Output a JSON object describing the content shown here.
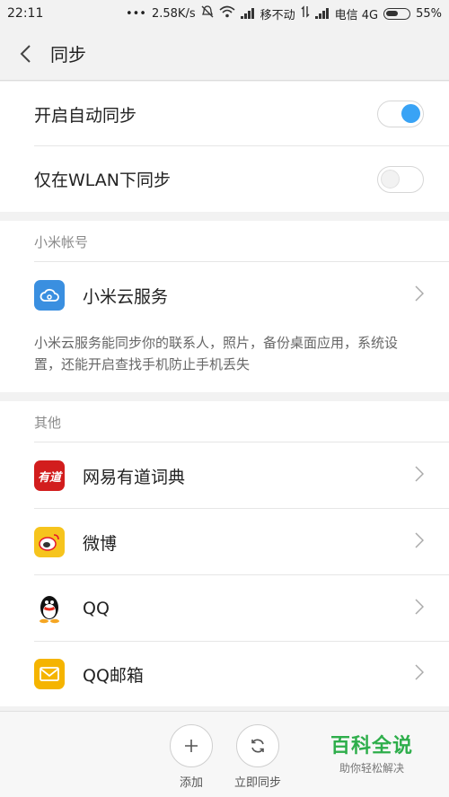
{
  "status_bar": {
    "time": "22:11",
    "dots": "•••",
    "speed": "2.58K/s",
    "carrier1": "移不动",
    "carrier2": "电信 4G",
    "battery": "55%"
  },
  "header": {
    "title": "同步"
  },
  "sync_settings": {
    "auto_sync_label": "开启自动同步",
    "auto_sync_on": true,
    "wlan_only_label": "仅在WLAN下同步",
    "wlan_only_on": false
  },
  "xiaomi_account": {
    "section_title": "小米帐号",
    "cloud_label": "小米云服务",
    "description": "小米云服务能同步你的联系人，照片，备份桌面应用，系统设置，还能开启查找手机防止手机丢失"
  },
  "others": {
    "section_title": "其他",
    "items": [
      {
        "label": "网易有道词典",
        "icon": "youdao-icon"
      },
      {
        "label": "微博",
        "icon": "weibo-icon"
      },
      {
        "label": "QQ",
        "icon": "qq-icon"
      },
      {
        "label": "QQ邮箱",
        "icon": "qqmail-icon"
      }
    ]
  },
  "bottom_bar": {
    "add_label": "添加",
    "sync_now_label": "立即同步",
    "watermark_title": "百科全说",
    "watermark_sub": "助你轻松解决"
  },
  "colors": {
    "toggle_on": "#39a3f5",
    "watermark": "#2eae4b"
  }
}
